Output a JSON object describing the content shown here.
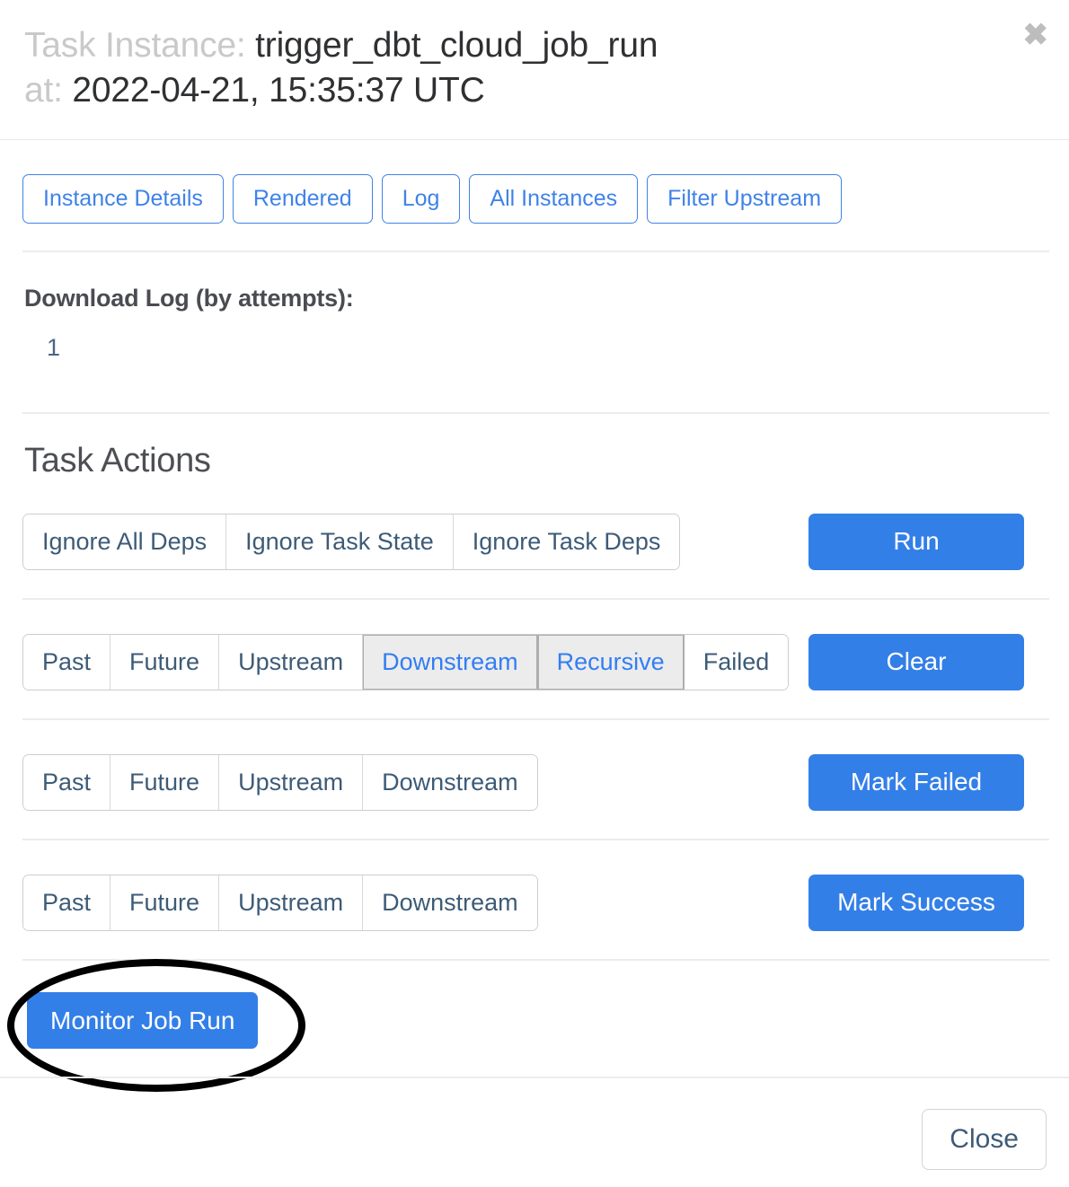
{
  "header": {
    "label_task_instance": "Task Instance:",
    "task_id": "trigger_dbt_cloud_job_run",
    "label_at": "at:",
    "execution_date": "2022-04-21, 15:35:37 UTC",
    "close_icon": "close-icon",
    "close_glyph": "✖"
  },
  "nav_buttons": [
    {
      "label": "Instance Details"
    },
    {
      "label": "Rendered"
    },
    {
      "label": "Log"
    },
    {
      "label": "All Instances"
    },
    {
      "label": "Filter Upstream"
    }
  ],
  "download_log": {
    "label": "Download Log (by attempts):",
    "attempts": [
      "1"
    ]
  },
  "task_actions": {
    "title": "Task Actions",
    "rows": [
      {
        "name": "run",
        "options": [
          {
            "label": "Ignore All Deps",
            "active": false
          },
          {
            "label": "Ignore Task State",
            "active": false
          },
          {
            "label": "Ignore Task Deps",
            "active": false
          }
        ],
        "action_label": "Run"
      },
      {
        "name": "clear",
        "options": [
          {
            "label": "Past",
            "active": false
          },
          {
            "label": "Future",
            "active": false
          },
          {
            "label": "Upstream",
            "active": false
          },
          {
            "label": "Downstream",
            "active": true
          },
          {
            "label": "Recursive",
            "active": true
          },
          {
            "label": "Failed",
            "active": false
          }
        ],
        "action_label": "Clear"
      },
      {
        "name": "mark-failed",
        "options": [
          {
            "label": "Past",
            "active": false
          },
          {
            "label": "Future",
            "active": false
          },
          {
            "label": "Upstream",
            "active": false
          },
          {
            "label": "Downstream",
            "active": false
          }
        ],
        "action_label": "Mark Failed"
      },
      {
        "name": "mark-success",
        "options": [
          {
            "label": "Past",
            "active": false
          },
          {
            "label": "Future",
            "active": false
          },
          {
            "label": "Upstream",
            "active": false
          },
          {
            "label": "Downstream",
            "active": false
          }
        ],
        "action_label": "Mark Success"
      }
    ]
  },
  "extra_links": {
    "monitor_job_run": "Monitor Job Run"
  },
  "footer": {
    "close_label": "Close"
  },
  "colors": {
    "primary": "#337fe8",
    "nav_border": "#3f83e8",
    "segment_text": "#3d5b77",
    "segment_active_bg": "#ececec",
    "segment_active_text": "#337ef2",
    "divider": "#ececec",
    "annotation": "#000000"
  }
}
